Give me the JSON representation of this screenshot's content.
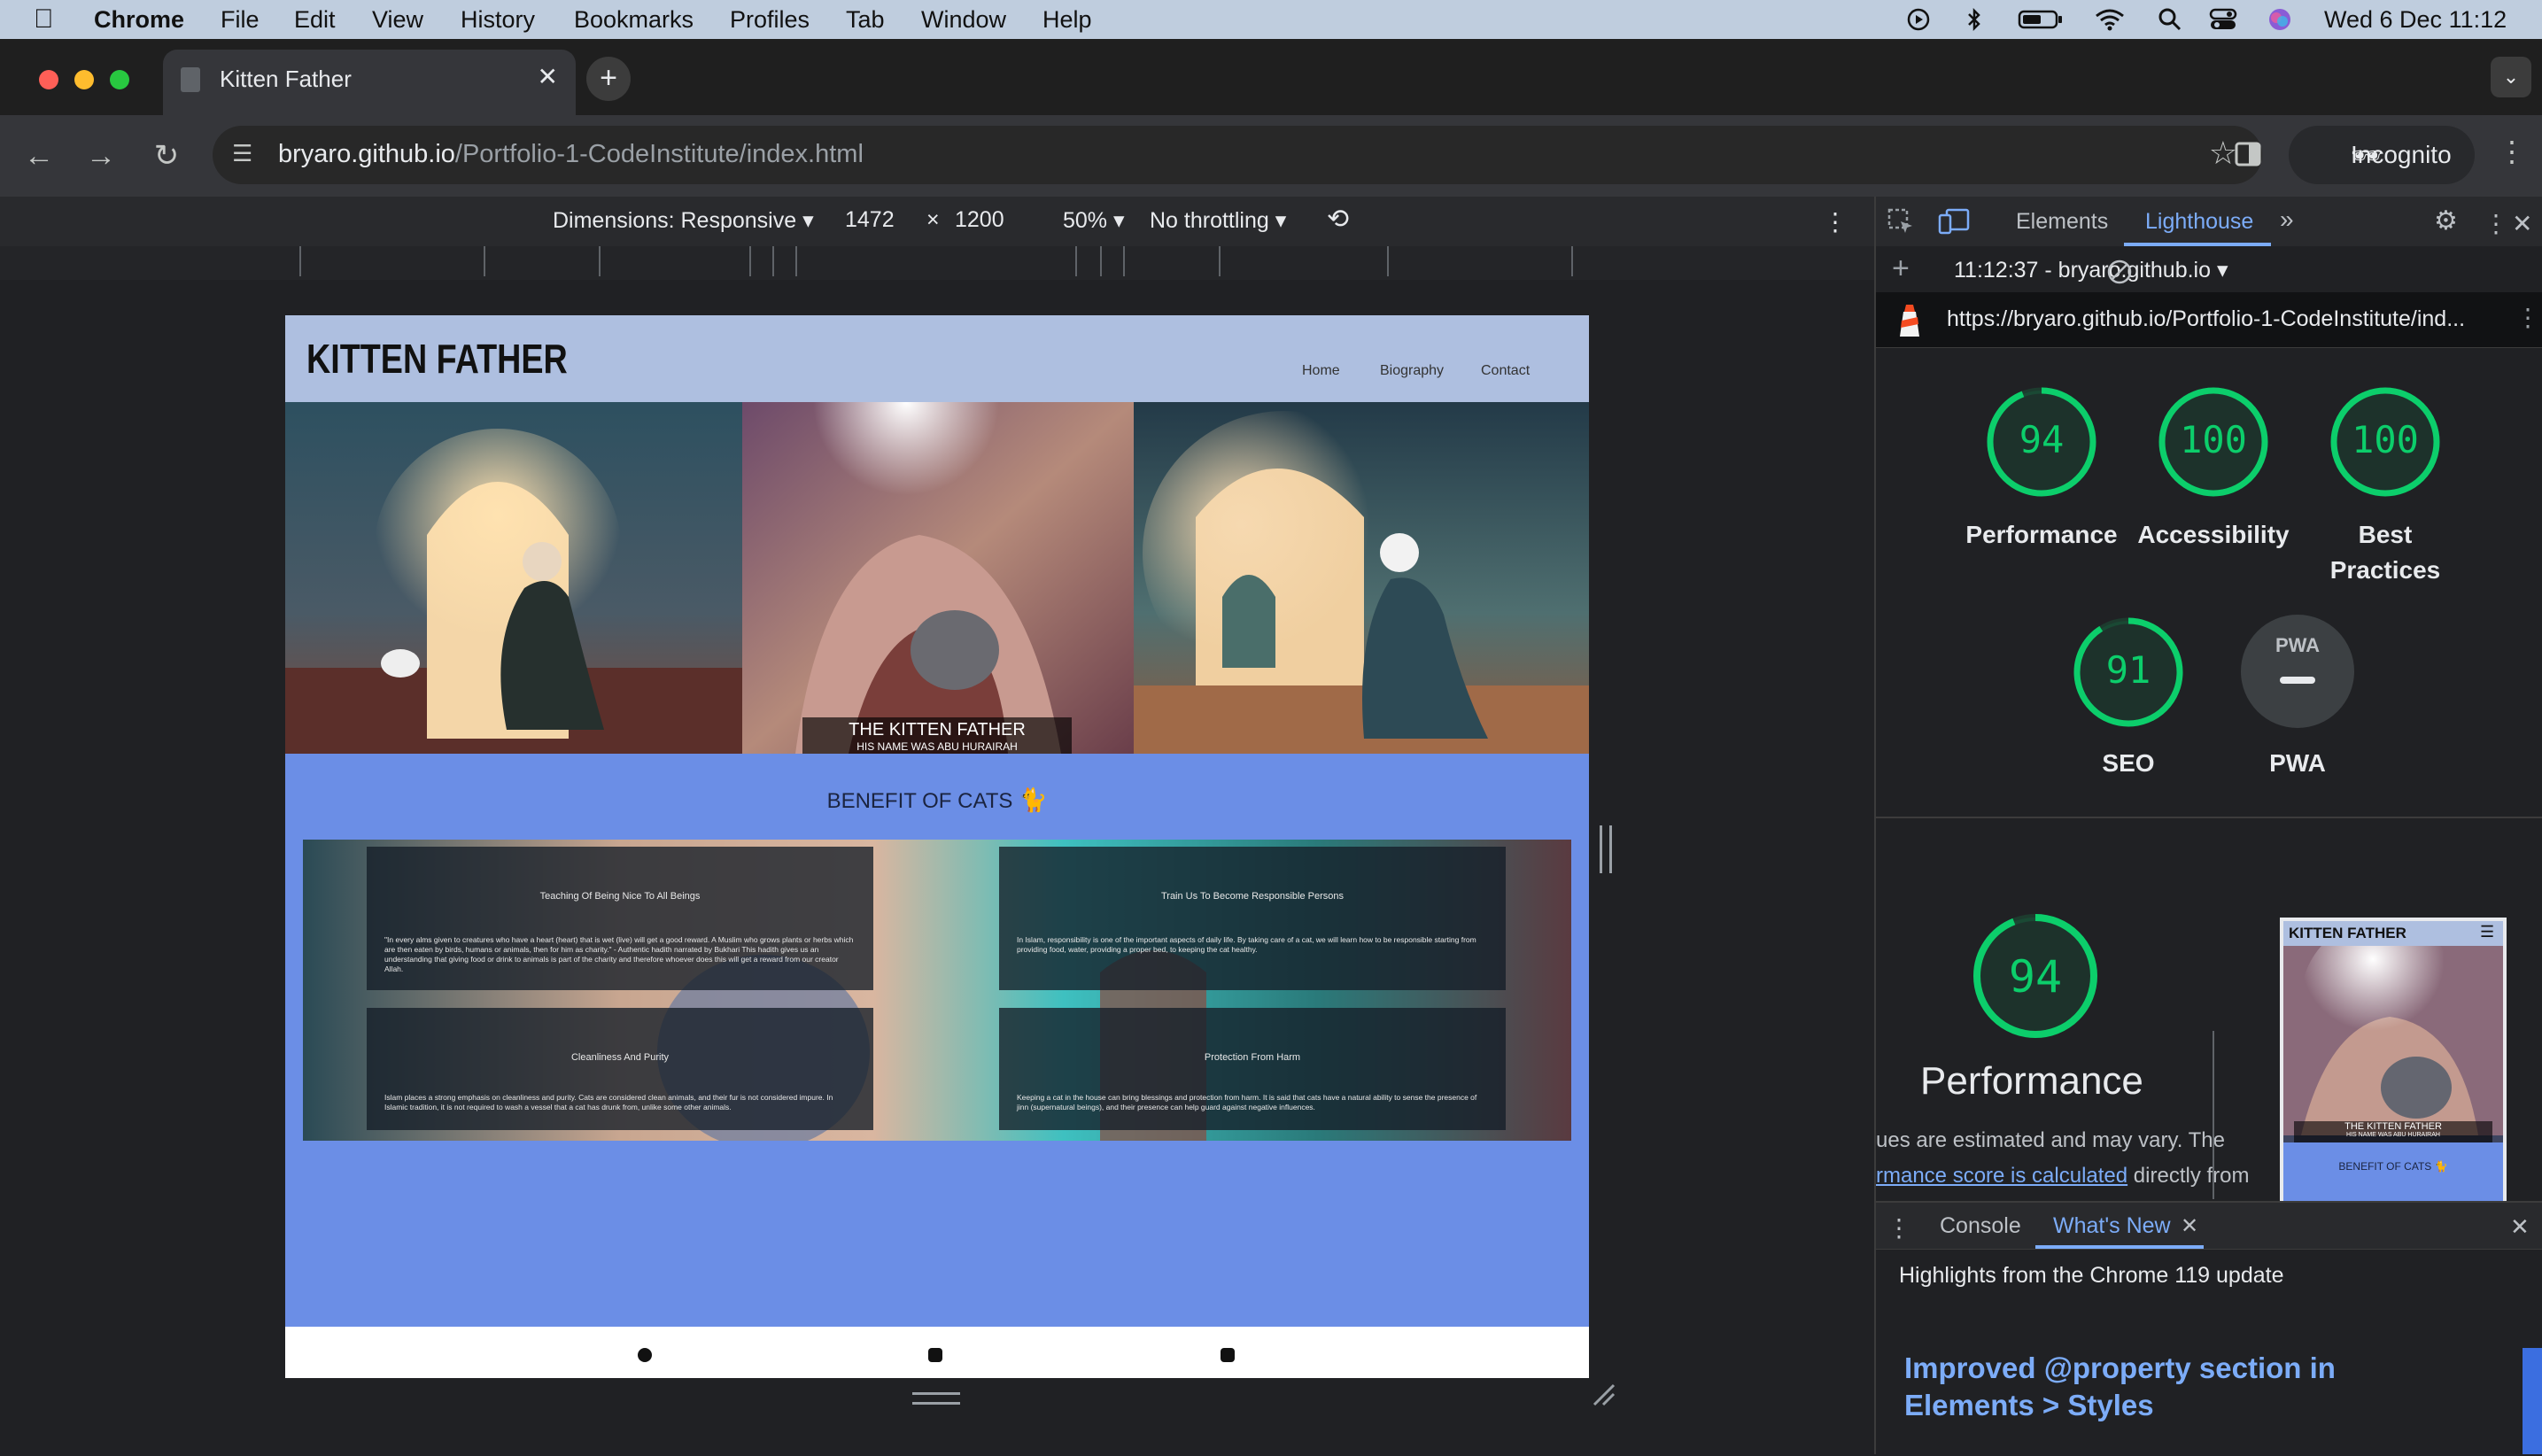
{
  "menubar": {
    "app": "Chrome",
    "items": [
      "File",
      "Edit",
      "View",
      "History",
      "Bookmarks",
      "Profiles",
      "Tab",
      "Window",
      "Help"
    ],
    "clock": "Wed 6 Dec  11:12"
  },
  "browser": {
    "tab_title": "Kitten Father",
    "url_host": "bryaro.github.io",
    "url_path": "/Portfolio-1-CodeInstitute/index.html",
    "incognito_label": "Incognito"
  },
  "device_toolbar": {
    "dimensions": "Dimensions: Responsive",
    "width": "1472",
    "height": "1200",
    "zoom": "50%",
    "throttling": "No throttling"
  },
  "site": {
    "logo": "KITTEN FATHER",
    "nav": [
      "Home",
      "Biography",
      "Contact"
    ],
    "hero_caption_title": "THE KITTEN FATHER",
    "hero_caption_sub": "HIS NAME WAS ABU HURAIRAH",
    "benefit_title": "BENEFIT OF CATS",
    "cards": [
      {
        "heading": "Teaching Of Being Nice To All Beings",
        "body": "\"In every alms given to creatures who have a heart (heart) that is wet (live) will get a good reward. A Muslim who grows plants or herbs which are then eaten by birds, humans or animals, then for him as charity.\" - Authentic hadith narrated by Bukhari This hadith gives us an understanding that giving food or drink to animals is part of the charity and therefore whoever does this will get a reward from our creator Allah."
      },
      {
        "heading": "Train Us To Become Responsible Persons",
        "body": "In Islam, responsibility is one of the important aspects of daily life. By taking care of a cat, we will learn how to be responsible starting from providing food, water, providing a proper bed, to keeping the cat healthy."
      },
      {
        "heading": "Cleanliness And Purity",
        "body": "Islam places a strong emphasis on cleanliness and purity. Cats are considered clean animals, and their fur is not considered impure. In Islamic tradition, it is not required to wash a vessel that a cat has drunk from, unlike some other animals."
      },
      {
        "heading": "Protection From Harm",
        "body": "Keeping a cat in the house can bring blessings and protection from harm. It is said that cats have a natural ability to sense the presence of jinn (supernatural beings), and their presence can help guard against negative influences."
      }
    ]
  },
  "devtools": {
    "tabs": [
      "Elements",
      "Lighthouse"
    ],
    "run_label": "11:12:37 - bryaro.github.io",
    "report_url": "https://bryaro.github.io/Portfolio-1-CodeInstitute/ind...",
    "scores": [
      {
        "name": "Performance",
        "value": 94
      },
      {
        "name": "Accessibility",
        "value": 100
      },
      {
        "name": "Best Practices",
        "value": 100
      },
      {
        "name": "SEO",
        "value": 91
      }
    ],
    "pwa_label": "PWA",
    "pwa_badge": "PWA",
    "perf_big_value": "94",
    "perf_big_label": "Performance",
    "perf_note_1": "ues are estimated and may vary. The",
    "perf_note_2_link": "rmance score is calculated",
    "perf_note_2_rest": " directly from",
    "thumb_logo": "KITTEN FATHER",
    "thumb_caption": "THE KITTEN FATHER",
    "thumb_caption_sub": "HIS NAME WAS ABU HURAIRAH",
    "thumb_benefit": "BENEFIT OF CATS",
    "drawer_tabs": [
      "Console",
      "What's New"
    ],
    "whatsnew_title": "Highlights from the Chrome 119 update",
    "whatsnew_heading": "Improved @property section in Elements > Styles"
  },
  "colors": {
    "score_good": "#0cce6b",
    "site_header": "#aebfe0",
    "site_body": "#6b8ee6",
    "accent_blue": "#7cacf8"
  }
}
